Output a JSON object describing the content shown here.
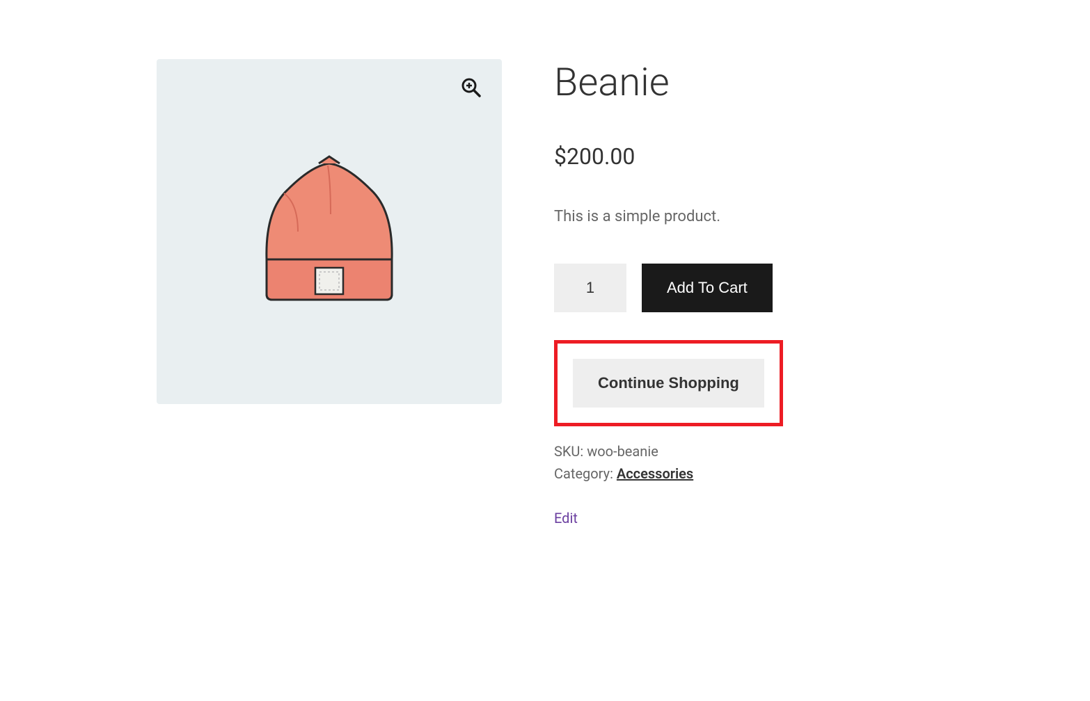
{
  "product": {
    "title": "Beanie",
    "price": "$200.00",
    "description": "This is a simple product.",
    "quantity": "1",
    "add_to_cart_label": "Add To Cart",
    "continue_shopping_label": "Continue Shopping",
    "sku_label": "SKU: ",
    "sku_value": "woo-beanie",
    "category_label": "Category: ",
    "category_value": "Accessories",
    "edit_label": "Edit"
  }
}
